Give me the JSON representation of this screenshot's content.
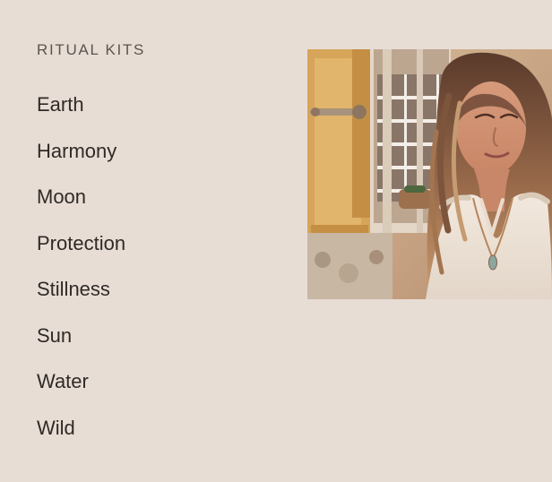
{
  "ritual_kits": {
    "heading": "RITUAL KITS",
    "items": [
      {
        "label": "Earth"
      },
      {
        "label": "Harmony"
      },
      {
        "label": "Moon"
      },
      {
        "label": "Protection"
      },
      {
        "label": "Stillness"
      },
      {
        "label": "Sun"
      },
      {
        "label": "Water"
      },
      {
        "label": "Wild"
      }
    ]
  },
  "theme": {
    "background": "#e8ddd5",
    "text": "#2f2a27",
    "heading_text": "#5a5550"
  }
}
